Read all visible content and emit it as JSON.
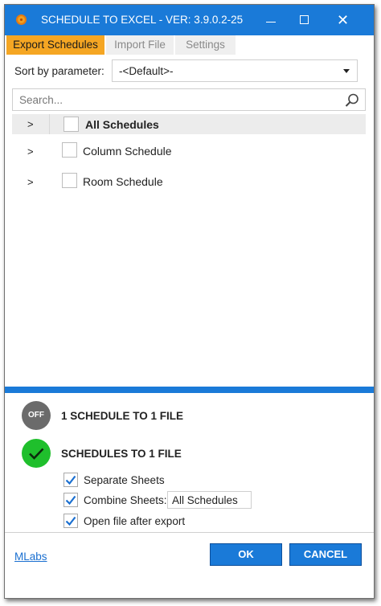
{
  "window": {
    "title": "SCHEDULE TO EXCEL - VER: 3.9.0.2-25",
    "minimize": "minimize",
    "maximize": "maximize",
    "close": "✕"
  },
  "tabs": [
    {
      "label": "Export Schedules",
      "active": true
    },
    {
      "label": "Import File",
      "active": false
    },
    {
      "label": "Settings",
      "active": false
    }
  ],
  "sort": {
    "label": "Sort by parameter:",
    "value": "-<Default>-"
  },
  "search": {
    "placeholder": "Search...",
    "value": ""
  },
  "tree": {
    "header": {
      "expander": ">",
      "label": "All Schedules",
      "checked": false
    },
    "items": [
      {
        "expander": ">",
        "label": "Column Schedule",
        "checked": false
      },
      {
        "expander": ">",
        "label": "Room Schedule",
        "checked": false
      }
    ]
  },
  "export_modes": {
    "mode1": {
      "toggle": "OFF",
      "label": "1 SCHEDULE TO 1 FILE",
      "on": false
    },
    "mode2": {
      "label": "SCHEDULES TO 1 FILE",
      "on": true
    }
  },
  "options": {
    "separate_sheets": {
      "label": "Separate Sheets",
      "checked": true
    },
    "combine_sheets": {
      "label": "Combine Sheets:",
      "checked": true,
      "value": "All Schedules"
    },
    "open_after_export": {
      "label": "Open file after export",
      "checked": true
    }
  },
  "footer": {
    "link": "MLabs",
    "ok": "OK",
    "cancel": "CANCEL"
  },
  "colors": {
    "accent_blue": "#1a7ad8",
    "active_tab": "#f5a623",
    "on_green": "#1fbf2c",
    "off_gray": "#6b6b6b"
  }
}
